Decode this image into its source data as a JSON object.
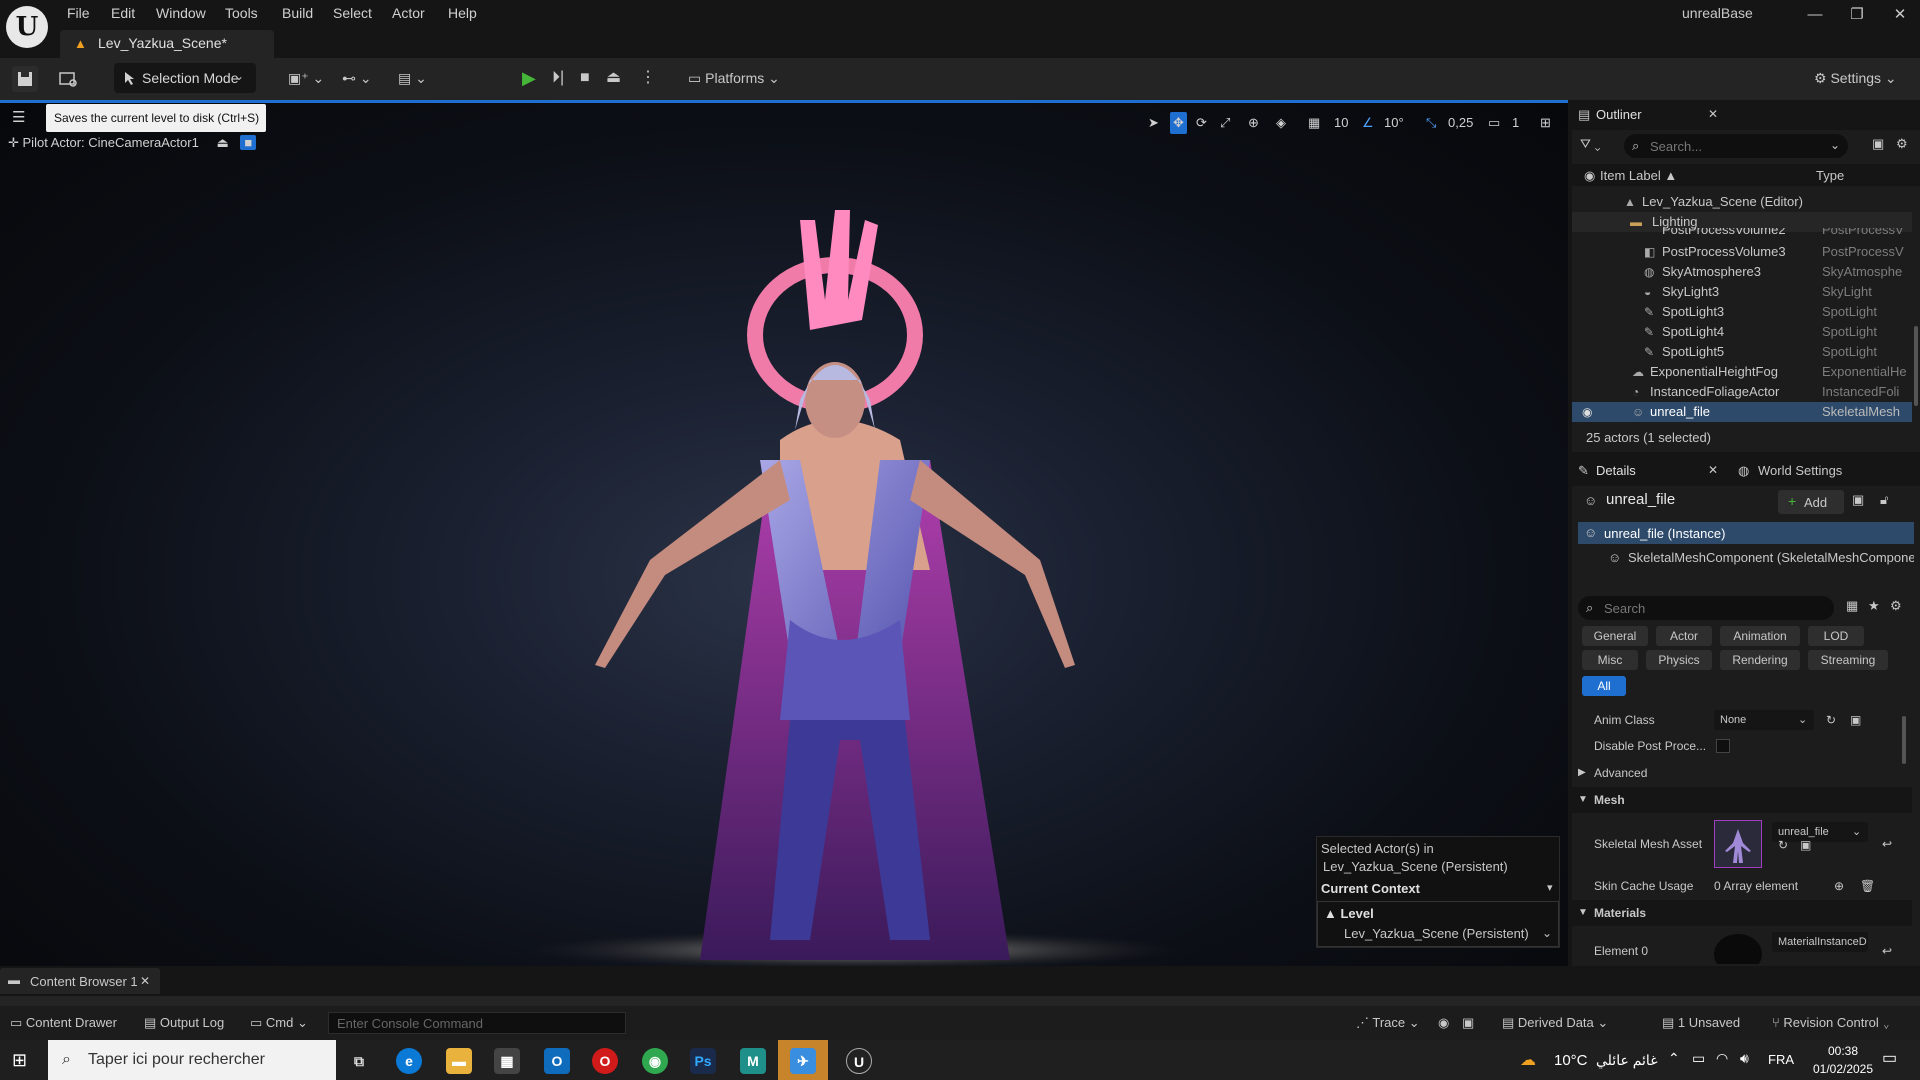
{
  "app": {
    "window_title": "unrealBase",
    "logo": "unreal-logo"
  },
  "menu": [
    "File",
    "Edit",
    "Window",
    "Tools",
    "Build",
    "Select",
    "Actor",
    "Help"
  ],
  "tab": {
    "label": "Lev_Yazkua_Scene*"
  },
  "toolbar": {
    "selection_mode": "Selection Mode",
    "platforms": "Platforms",
    "settings": "Settings"
  },
  "tooltip": "Saves the current level to disk (Ctrl+S)",
  "viewport": {
    "pilot_label": "Pilot Actor: CineCameraActor1",
    "grid_value": "10",
    "angle_value": "10°",
    "scale_value": "0,25",
    "camera_speed": "1",
    "context": {
      "selected_line1": "Selected Actor(s) in",
      "selected_line2": "Lev_Yazkua_Scene (Persistent)",
      "current_context": "Current Context",
      "level_label": "Level",
      "level_value": "Lev_Yazkua_Scene (Persistent)"
    }
  },
  "outliner": {
    "title": "Outliner",
    "search_placeholder": "Search...",
    "col_label": "Item Label ▲",
    "col_type": "Type",
    "rows": [
      {
        "name": "Lev_Yazkua_Scene (Editor)",
        "type": ""
      },
      {
        "name": "Lighting",
        "type": ""
      },
      {
        "name": "PostProcessVolume2",
        "type": "PostProcessV"
      },
      {
        "name": "PostProcessVolume3",
        "type": "PostProcessV"
      },
      {
        "name": "SkyAtmosphere3",
        "type": "SkyAtmosphe"
      },
      {
        "name": "SkyLight3",
        "type": "SkyLight"
      },
      {
        "name": "SpotLight3",
        "type": "SpotLight"
      },
      {
        "name": "SpotLight4",
        "type": "SpotLight"
      },
      {
        "name": "SpotLight5",
        "type": "SpotLight"
      },
      {
        "name": "ExponentialHeightFog",
        "type": "ExponentialHe"
      },
      {
        "name": "InstancedFoliageActor",
        "type": "InstancedFoli"
      },
      {
        "name": "unreal_file",
        "type": "SkeletalMesh"
      }
    ],
    "footer": "25 actors (1 selected)"
  },
  "details": {
    "tab_details": "Details",
    "tab_world": "World Settings",
    "actor_name": "unreal_file",
    "add_label": "Add",
    "instance_label": "unreal_file (Instance)",
    "component_label": "SkeletalMeshComponent (SkeletalMeshCompone",
    "search_placeholder": "Search",
    "categories": [
      "General",
      "Actor",
      "Animation",
      "LOD",
      "Misc",
      "Physics",
      "Rendering",
      "Streaming",
      "All"
    ],
    "anim_class_label": "Anim Class",
    "anim_class_value": "None",
    "disable_post_label": "Disable Post Proce...",
    "advanced_label": "Advanced",
    "mesh_section": "Mesh",
    "skeletal_mesh_label": "Skeletal Mesh Asset",
    "skeletal_mesh_value": "unreal_file",
    "skin_cache_label": "Skin Cache Usage",
    "skin_cache_value": "0 Array element",
    "materials_section": "Materials",
    "element0_label": "Element 0",
    "element0_value": "MaterialInstanceD"
  },
  "bottom": {
    "content_browser_tab": "Content Browser 1",
    "content_drawer": "Content Drawer",
    "output_log": "Output Log",
    "cmd": "Cmd",
    "console_placeholder": "Enter Console Command",
    "trace": "Trace",
    "derived_data": "Derived Data",
    "unsaved": "1 Unsaved",
    "revision_control": "Revision Control"
  },
  "taskbar": {
    "search_placeholder": "Taper ici pour rechercher",
    "weather": "10°C",
    "weather_desc": "غائم عائلي",
    "lang": "FRA",
    "time": "00:38",
    "date": "01/02/2025"
  }
}
